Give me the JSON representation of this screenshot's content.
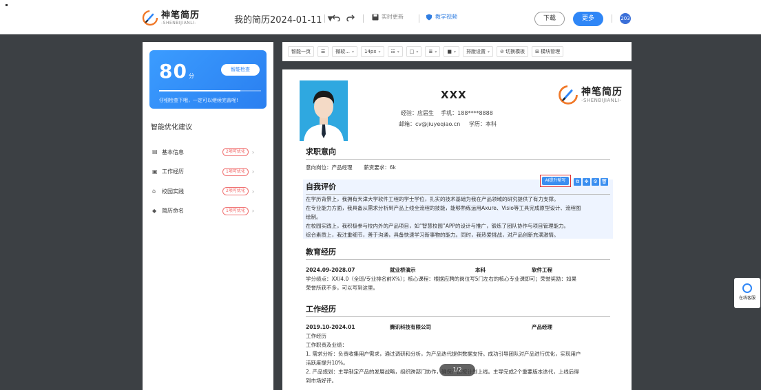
{
  "header": {
    "brand_title": "神笔简历",
    "brand_sub": "-SHENBIJIANLI-",
    "doc_title": "我的简历2024-01-11",
    "realtime": "实时更新",
    "teaching": "教学视频",
    "download_label": "下载",
    "more_label": "更多",
    "avatar_text": "203",
    "accent": "#2f86f6"
  },
  "score": {
    "value": "80",
    "unit": "分",
    "check_label": "智能检查",
    "hint": "仔细检查下哦，一定可以继续完善呢!",
    "progress": 0.8
  },
  "suggestions": {
    "title": "智能优化建议",
    "items": [
      {
        "label": "基本信息",
        "badge": "2项可优化",
        "icon": "id-card-icon"
      },
      {
        "label": "工作经历",
        "badge": "1项可优化",
        "icon": "briefcase-icon"
      },
      {
        "label": "校园实践",
        "badge": "2项可优化",
        "icon": "campus-icon"
      },
      {
        "label": "简历命名",
        "badge": "1项可优化",
        "icon": "tag-icon"
      }
    ]
  },
  "toolbar": {
    "smart_page": "智能一页",
    "font": "微软...",
    "size": "14px",
    "layout": "排版设置",
    "switch_template": "切换模板",
    "module_manage": "模块管理"
  },
  "resume": {
    "name": "XXX",
    "experience_label": "经验：",
    "experience": "应届生",
    "phone_label": "手机：",
    "phone": "188****8888",
    "email_label": "邮箱：",
    "email": "cv@jiuyeqiao.cn",
    "edu_label": "学历：",
    "edu": "本科",
    "intent": {
      "title": "求职意向",
      "position": "意向岗位：产品经理",
      "salary": "薪资要求：6k"
    },
    "eval": {
      "title": "自我评价",
      "ai_label": "AI提升帮写",
      "lines": [
        "在学历背景上，我拥有天津大学软件工程的学士学位，扎实的技术基础为我在产品领域的研究提供了有力支撑。",
        "在专业能力方面，我具备从需求分析到产品上线全流程的技能，能够熟练运用Axure、Visio等工具完成原型设计、流程图",
        "绘制。",
        "在校园实践上，我积极参与校内外的产品项目，如“智慧校园”APP的设计与推广，锻炼了团队协作与项目管理能力。",
        "综合素质上，我注重细节，善于沟通，具备快速学习新事物的能力。同时，我热爱挑战，对产品创新充满激情。"
      ]
    },
    "education": {
      "title": "教育经历",
      "period": "2024.09-2028.07",
      "school": "就业桥演示",
      "degree": "本科",
      "major": "软件工程",
      "lines": [
        "学分绩点：XX/4.0（全班/专业排名前X%）；核心课程：根据应聘的岗位写5门左右的核心专业课即可；荣誉奖励：如果",
        "荣誉所获不多，可以写到这里。"
      ]
    },
    "work": {
      "title": "工作经历",
      "period": "2019.10-2024.01",
      "company": "腾讯科技有限公司",
      "role": "产品经理",
      "lines": [
        "工作经历",
        "工作职责及业绩：",
        "1. 需求分析：负责收集用户需求，通过调研和分析，为产品迭代提供数据支持。成功引导团队对产品进行优化，实现用户",
        "活跃度提升10%。",
        "2. 产品规划：主导制定产品的发展战略，组织跨部门协作，确保产品按计划上线。主导完成2个重要版本迭代，上线后得",
        "到市场好评。"
      ]
    }
  },
  "pager": "1/2",
  "service_label": "在线客服"
}
